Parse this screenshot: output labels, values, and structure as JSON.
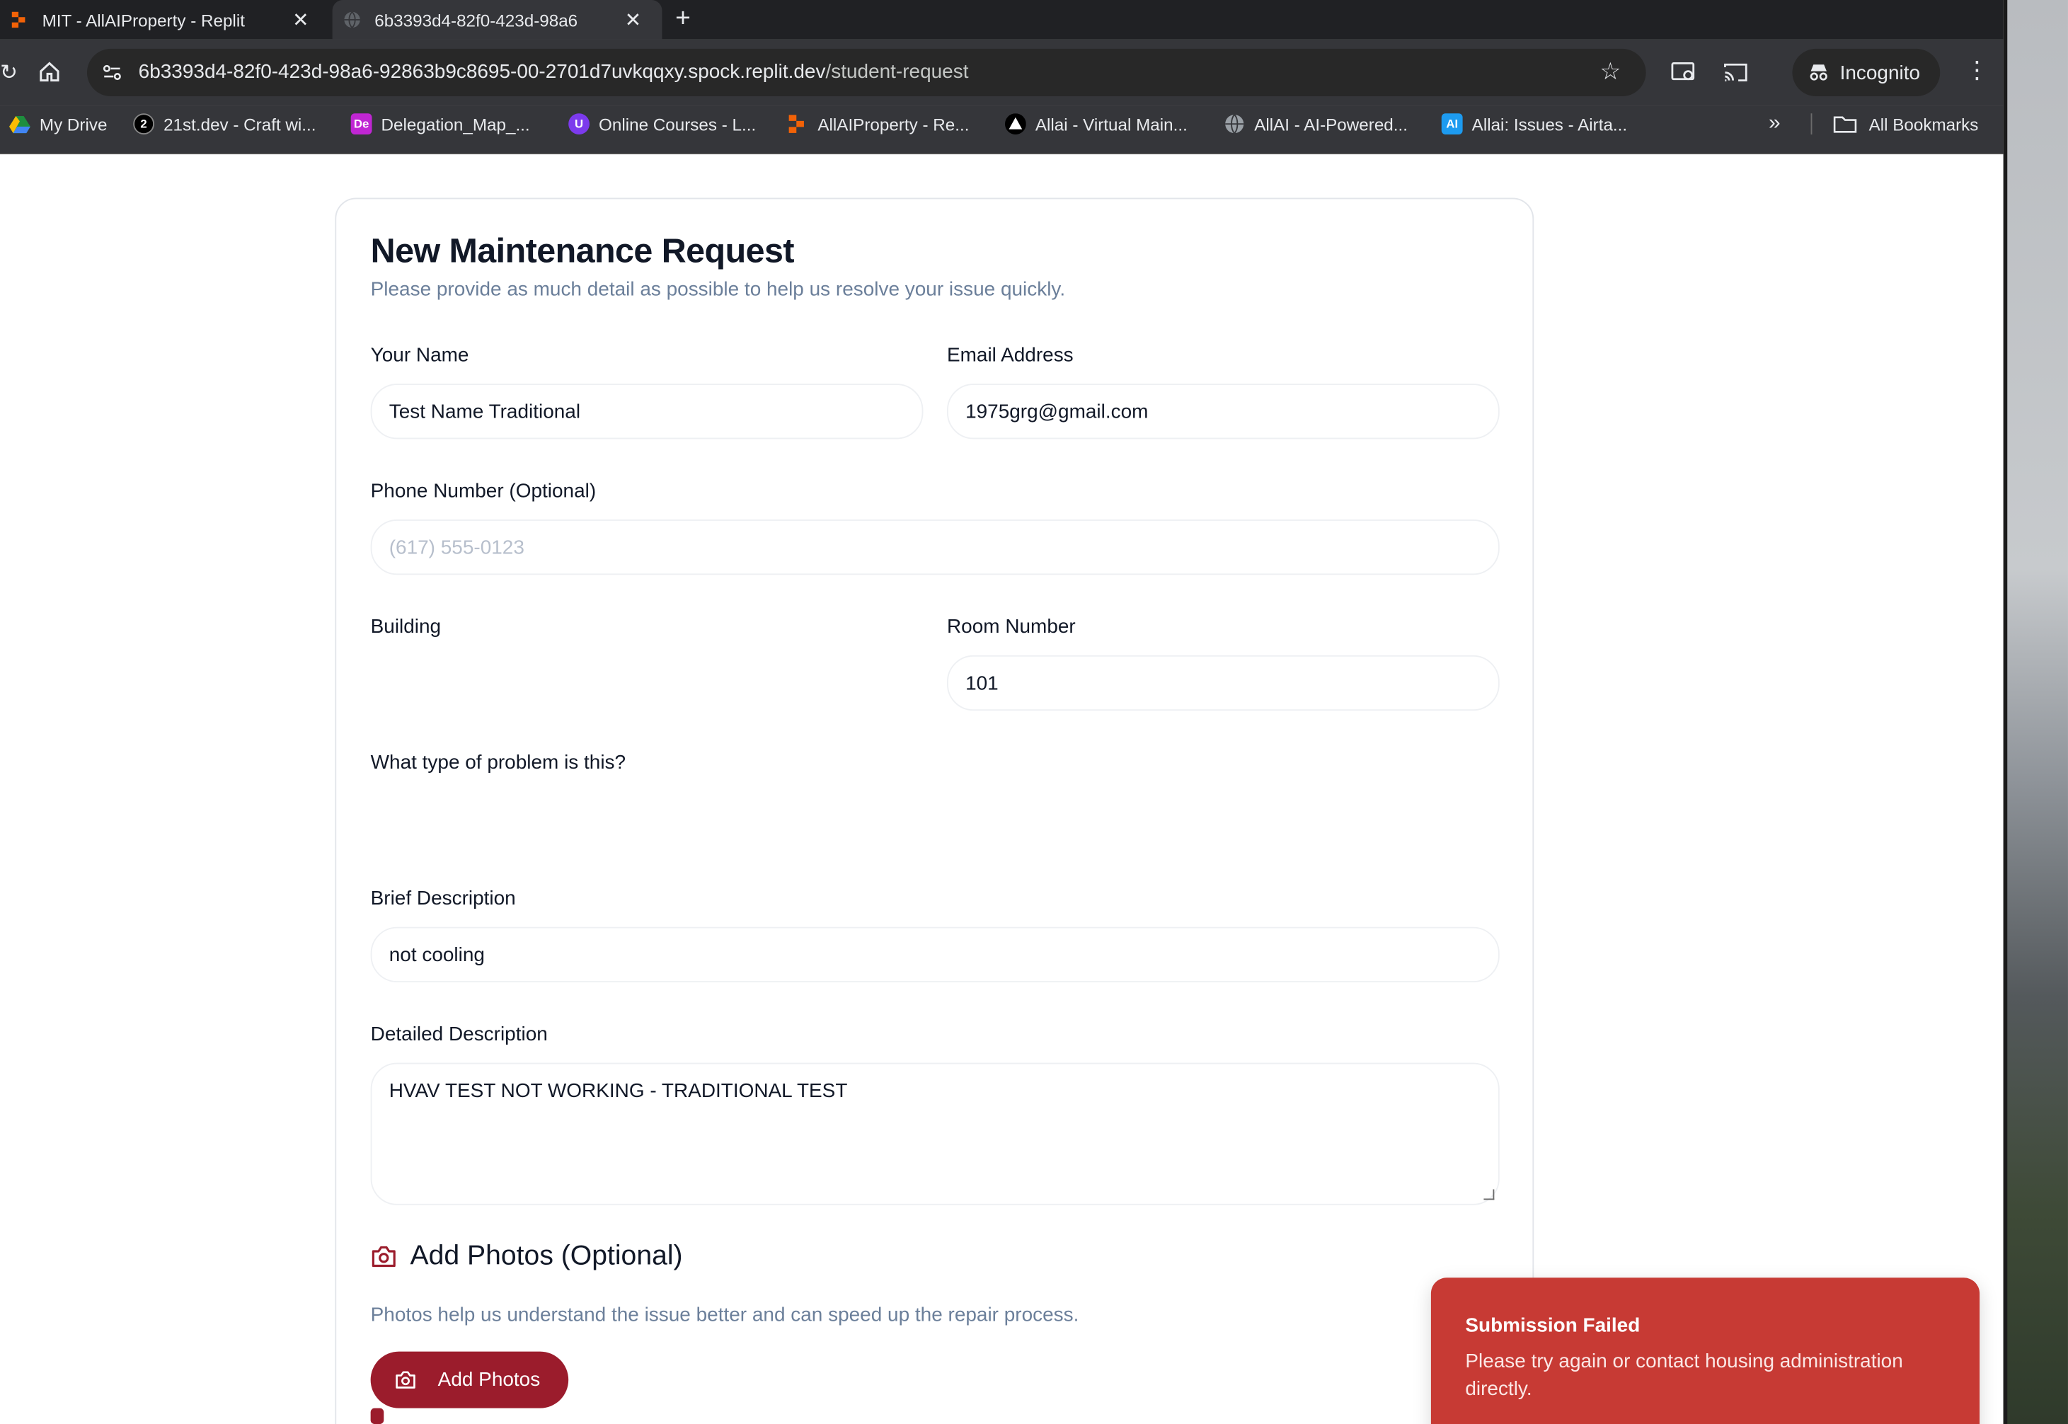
{
  "browser": {
    "tabs": [
      {
        "title": "MIT - AllAIProperty - Replit",
        "active": false,
        "close_label": "✕"
      },
      {
        "title": "6b3393d4-82f0-423d-98a6",
        "active": true,
        "close_label": "✕"
      }
    ],
    "new_tab_label": "+",
    "address": {
      "host": "6b3393d4-82f0-423d-98a6-92863b9c8695-00-2701d7uvkqqxy.spock.replit.dev",
      "path": "/student-request"
    },
    "incognito_label": "Incognito",
    "bookmarks": [
      {
        "label": "My Drive",
        "icon": "drive-icon",
        "color": "#1e8e3e"
      },
      {
        "label": "21st.dev - Craft wi...",
        "icon": "21st-icon",
        "color": "#000000"
      },
      {
        "label": "Delegation_Map_...",
        "icon": "De",
        "color": "#c026d3"
      },
      {
        "label": "Online Courses - L...",
        "icon": "U",
        "color": "#7c3aed"
      },
      {
        "label": "AllAIProperty - Re...",
        "icon": "replit-icon",
        "color": "#f26207"
      },
      {
        "label": "Allai - Virtual Main...",
        "icon": "triangle-icon",
        "color": "#000000"
      },
      {
        "label": "AllAI - AI-Powered...",
        "icon": "globe-icon",
        "color": "#5f6368"
      },
      {
        "label": "Allai: Issues - Airta...",
        "icon": "AI",
        "color": "#1d9bf0"
      }
    ],
    "all_bookmarks_label": "All Bookmarks",
    "more_label": "»"
  },
  "form": {
    "title": "New Maintenance Request",
    "subtitle": "Please provide as much detail as possible to help us resolve your issue quickly.",
    "name": {
      "label": "Your Name",
      "value": "Test Name Traditional"
    },
    "email": {
      "label": "Email Address",
      "value": "1975grg@gmail.com"
    },
    "phone": {
      "label": "Phone Number (Optional)",
      "placeholder": "(617) 555-0123"
    },
    "building": {
      "label": "Building"
    },
    "room": {
      "label": "Room Number",
      "value": "101"
    },
    "problem_type": {
      "label": "What type of problem is this?"
    },
    "brief": {
      "label": "Brief Description",
      "value": "not cooling"
    },
    "detailed": {
      "label": "Detailed Description",
      "value": "HVAV TEST NOT WORKING - TRADITIONAL TEST"
    },
    "photos": {
      "title": "Add Photos (Optional)",
      "hint": "Photos help us understand the issue better and can speed up the repair process.",
      "button_label": "Add Photos"
    }
  },
  "toast": {
    "title": "Submission Failed",
    "message": "Please try again or contact housing administration directly.",
    "color": "#c73a34"
  }
}
